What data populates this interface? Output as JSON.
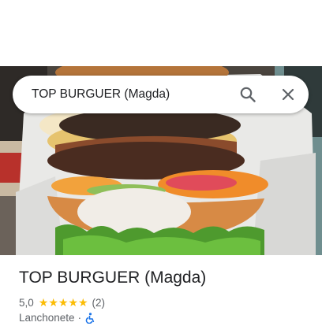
{
  "search": {
    "query": "TOP BURGUER (Magda)",
    "search_icon": "search-icon",
    "close_icon": "close-icon"
  },
  "photo": {
    "subject": "burger-photo"
  },
  "place": {
    "name": "TOP BURGUER (Magda)",
    "rating": "5,0",
    "stars": "★★★★★",
    "reviews": "(2)",
    "category": "Lanchonete",
    "separator": "·",
    "accessibility_icon": "wheelchair-icon"
  },
  "colors": {
    "star": "#fbbc04",
    "accessibility": "#1a73e8",
    "text_primary": "#202124",
    "text_secondary": "#5f6368"
  }
}
